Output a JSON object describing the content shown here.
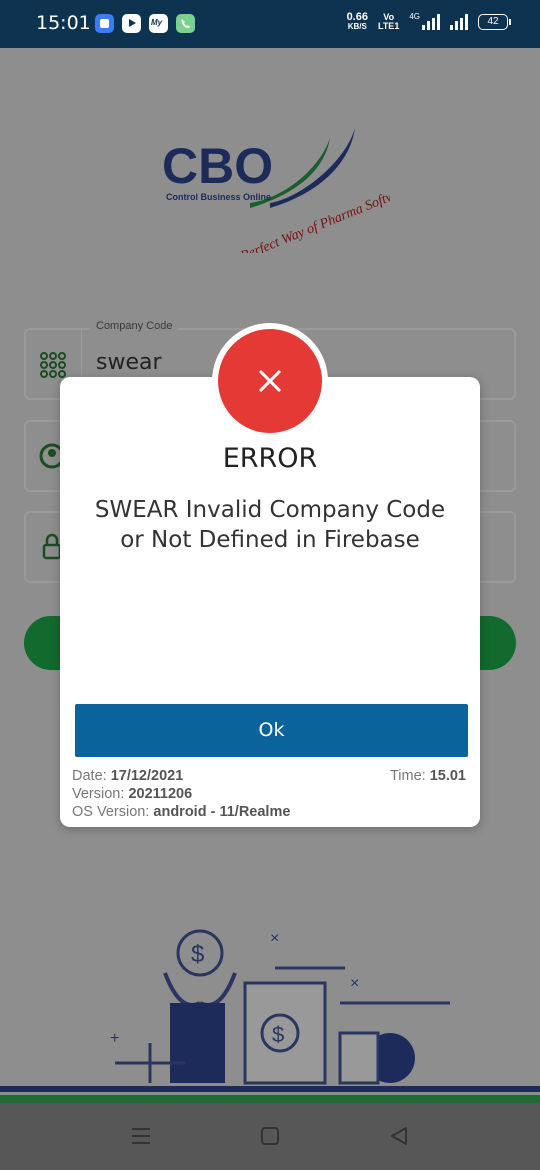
{
  "status_bar": {
    "time": "15:01",
    "speed_value": "0.66",
    "speed_unit": "KB/S",
    "volte_top": "Vo",
    "volte_bottom": "LTE1",
    "network": "4G",
    "battery": "42"
  },
  "app": {
    "company_code_label": "Company Code",
    "company_code_value": "swear"
  },
  "dialog": {
    "title": "ERROR",
    "message": "SWEAR Invalid Company Code or Not Defined in Firebase",
    "ok_label": "Ok",
    "date_label": "Date:",
    "date_value": "17/12/2021",
    "time_label": "Time:",
    "time_value": "15.01",
    "version_label": "Version:",
    "version_value": "20211206",
    "os_label": "OS Version:",
    "os_value": "android - 11/Realme"
  },
  "colors": {
    "error_red": "#e53935",
    "ok_blue": "#0b639c",
    "status_bar": "#0d3350"
  }
}
